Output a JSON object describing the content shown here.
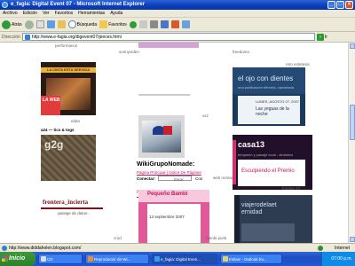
{
  "window": {
    "title": "e_fagia: Digital Event 07 - Microsoft Internet Explorer",
    "min": "_",
    "max": "□",
    "close": "×"
  },
  "menu": [
    "Archivo",
    "Edición",
    "Ver",
    "Favoritos",
    "Herramientas",
    "Ayuda"
  ],
  "toolbar": {
    "back": "Atrás",
    "search": "Búsqueda",
    "favorites": "Favoritos"
  },
  "address": {
    "label": "Dirección",
    "url": "http://www.e-fagia.org/digevent07/pieces.html",
    "go": "Ir"
  },
  "captions": {
    "performance": "performance",
    "sunny": "sunnyvideo",
    "freedomo": "freedomo",
    "reto": "reto estetesis",
    "web": "edan",
    "xxz": "xxz",
    "tics": "a24 — tics & togs",
    "linkar": "linkar",
    "web_nomade": "web nomade",
    "crud": "crud",
    "fondes": "fondos 13",
    "bambi": "bambi punk"
  },
  "tiles": {
    "cinta": "LA CINTA ESTA SERVIDA",
    "web": "LA WEB",
    "g2g": "g2g",
    "frontera": "frontera_incierta",
    "frontera_sub": "-paisaje de datos-",
    "ojo": "el ojo con dientes",
    "ojo_sub": "una publicación efímera, cancelada",
    "ojo_date": "LUNES, AGOSTO 27, 2007",
    "ojo_post": "Las yeguas de la noche",
    "wiki": "WikiGrupoNomade:",
    "wiki_links": "Página Principal | Índice De Páginas",
    "wiki_connect": "Conectar:",
    "wiki_con": "Con",
    "nomade": "nomade",
    "casa": "casa13",
    "casa_sub": "benjamín y paisaje local - dinámico",
    "casa_post": "Esculpiendo el Premio",
    "bambi": "Pequeño Bambi",
    "bambi_date": "13 septiembre 2007",
    "viaje": "viajerodelaet ernidad"
  },
  "status": {
    "url": "http://www.diddahelen.blogspot.com/",
    "zone": "Internet"
  },
  "taskbar": {
    "start": "Inicio",
    "tasks": [
      "CD",
      "Reproductor de Wi...",
      "e_fagia: Digital Even...",
      "Imbrar - Outlook Ex..."
    ],
    "clock": "07:00 p.m."
  },
  "colors": {
    "titlebar": "#0b3db8",
    "taskbar": "#2457cf",
    "start": "#2b7f2b"
  }
}
